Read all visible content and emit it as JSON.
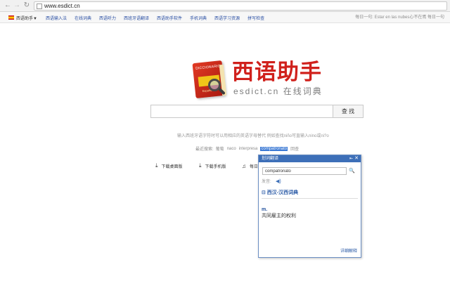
{
  "browser": {
    "url": "www.esdict.cn",
    "back_icon": "back-arrow-icon",
    "forward_icon": "forward-arrow-icon",
    "reload_icon": "reload-icon"
  },
  "nav": {
    "brand_menu": "西语助手▼",
    "links": [
      "西语输入法",
      "在线词典",
      "西语听力",
      "西班牙语翻译",
      "西语助手软件",
      "手机词典",
      "西语学习资源",
      "拼写检查"
    ],
    "daily": "每日一句: Estar en las nubes心不在焉 每日一句"
  },
  "logo": {
    "title": "西语助手",
    "subtitle": "esdict.cn 在线词典",
    "book_label": "DICCIONARIO",
    "book_sub": "Español"
  },
  "search": {
    "value": "",
    "button": "查 找"
  },
  "hint": "输入西班牙语字符时可以用相应的英语字母替代 例如查找niño可直输入nino或ni?o",
  "recent": {
    "label": "最近搜索:",
    "words": [
      "葡萄",
      "naco",
      "interpresa",
      "compatronato",
      "回查"
    ]
  },
  "downloads": {
    "desktop": "下载桌面版",
    "mobile": "下载手机版",
    "third": "每日"
  },
  "popup": {
    "title": "划词翻译",
    "pin": "⇤",
    "close": "✕",
    "query": "compatronato",
    "pron_label": "发音:",
    "section": "⊟ 西汉-汉西词典",
    "pos": "m.",
    "definition": "共同雇主的权利",
    "more": "详细解释"
  },
  "colors": {
    "brand_red": "#d0211c",
    "link_blue": "#2a4fa3",
    "popup_header": "#3d6fb8",
    "highlight": "#3b79d4"
  }
}
